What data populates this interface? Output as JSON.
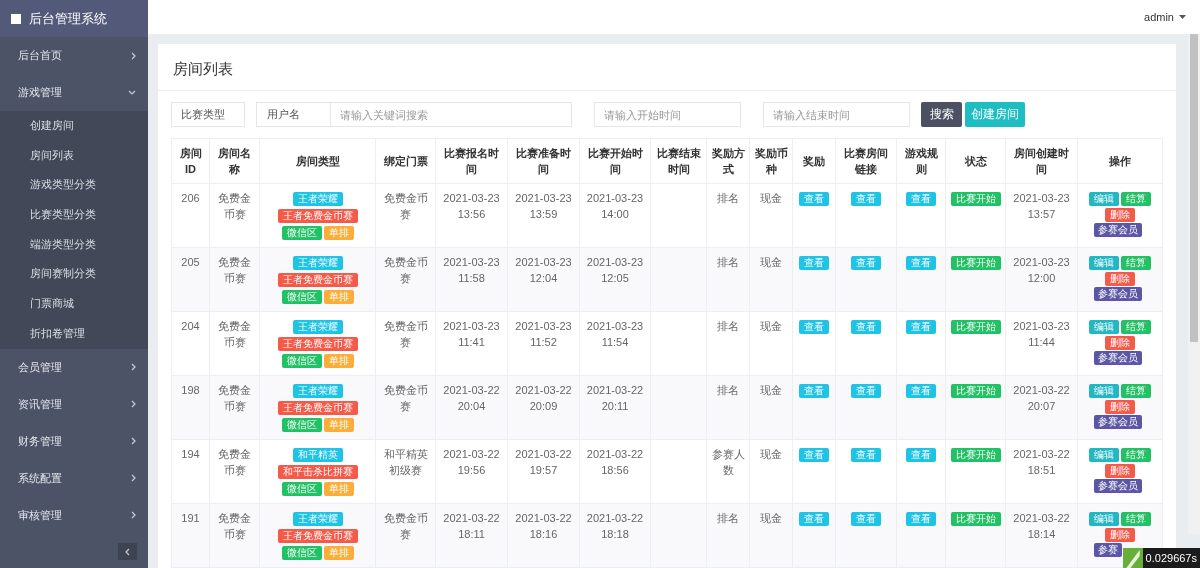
{
  "app_title": "后台管理系统",
  "user": "admin",
  "sidebar": [
    {
      "label": "后台首页",
      "expanded": false
    },
    {
      "label": "游戏管理",
      "expanded": true,
      "children": [
        "创建房间",
        "房间列表",
        "游戏类型分类",
        "比赛类型分类",
        "端游类型分类",
        "房间赛制分类",
        "门票商城",
        "折扣卷管理"
      ]
    },
    {
      "label": "会员管理",
      "expanded": false
    },
    {
      "label": "资讯管理",
      "expanded": false
    },
    {
      "label": "财务管理",
      "expanded": false
    },
    {
      "label": "系统配置",
      "expanded": false
    },
    {
      "label": "审核管理",
      "expanded": false
    }
  ],
  "page_title": "房间列表",
  "filters": {
    "type_select": "比赛类型",
    "keyword_label": "用户名",
    "keyword_placeholder": "请输入关键词搜索",
    "start_placeholder": "请输入开始时间",
    "end_placeholder": "请输入结束时间",
    "search_button": "搜索",
    "create_button": "创建房间"
  },
  "table": {
    "columns": [
      "房间ID",
      "房间名称",
      "房间类型",
      "绑定门票",
      "比赛报名时间",
      "比赛准备时间",
      "比赛开始时间",
      "比赛结束时间",
      "奖励方式",
      "奖励币种",
      "奖励",
      "比赛房间链接",
      "游戏规则",
      "状态",
      "房间创建时间",
      "操作"
    ],
    "rows": [
      {
        "id": "206",
        "name": "免费金币赛",
        "tags": [
          {
            "label": "王者荣耀",
            "color": "#1ec3e6"
          },
          {
            "label": "王者免费金币赛",
            "color": "#f35a4a"
          },
          {
            "label": "微信区",
            "color": "#23c165"
          },
          {
            "label": "单排",
            "color": "#fbad3b"
          }
        ],
        "ticket": "免费金币赛",
        "signup": "2021-03-23 13:56",
        "prep": "2021-03-23 13:59",
        "start": "2021-03-23 14:00",
        "reward_method": "排名",
        "currency": "现金",
        "reward": "查看",
        "link": "查看",
        "rules": "查看",
        "status": {
          "label": "比赛开始",
          "color": "#23c165"
        },
        "created": "2021-03-23 13:57",
        "actions": [
          {
            "label": "编辑",
            "color": "#23b7c3"
          },
          {
            "label": "结算",
            "color": "#23c165"
          },
          {
            "label": "删除",
            "color": "#f35a4a"
          },
          {
            "label": "参赛会员",
            "color": "#5b56a6"
          }
        ]
      },
      {
        "id": "205",
        "name": "免费金币赛",
        "tags": [
          {
            "label": "王者荣耀",
            "color": "#1ec3e6"
          },
          {
            "label": "王者免费金币赛",
            "color": "#f35a4a"
          },
          {
            "label": "微信区",
            "color": "#23c165"
          },
          {
            "label": "单排",
            "color": "#fbad3b"
          }
        ],
        "ticket": "免费金币赛",
        "signup": "2021-03-23 11:58",
        "prep": "2021-03-23 12:04",
        "start": "2021-03-23 12:05",
        "reward_method": "排名",
        "currency": "现金",
        "reward": "查看",
        "link": "查看",
        "rules": "查看",
        "status": {
          "label": "比赛开始",
          "color": "#23c165"
        },
        "created": "2021-03-23 12:00",
        "actions": [
          {
            "label": "编辑",
            "color": "#23b7c3"
          },
          {
            "label": "结算",
            "color": "#23c165"
          },
          {
            "label": "删除",
            "color": "#f35a4a"
          },
          {
            "label": "参赛会员",
            "color": "#5b56a6"
          }
        ]
      },
      {
        "id": "204",
        "name": "免费金币赛",
        "tags": [
          {
            "label": "王者荣耀",
            "color": "#1ec3e6"
          },
          {
            "label": "王者免费金币赛",
            "color": "#f35a4a"
          },
          {
            "label": "微信区",
            "color": "#23c165"
          },
          {
            "label": "单排",
            "color": "#fbad3b"
          }
        ],
        "ticket": "免费金币赛",
        "signup": "2021-03-23 11:41",
        "prep": "2021-03-23 11:52",
        "start": "2021-03-23 11:54",
        "reward_method": "排名",
        "currency": "现金",
        "reward": "查看",
        "link": "查看",
        "rules": "查看",
        "status": {
          "label": "比赛开始",
          "color": "#23c165"
        },
        "created": "2021-03-23 11:44",
        "actions": [
          {
            "label": "编辑",
            "color": "#23b7c3"
          },
          {
            "label": "结算",
            "color": "#23c165"
          },
          {
            "label": "删除",
            "color": "#f35a4a"
          },
          {
            "label": "参赛会员",
            "color": "#5b56a6"
          }
        ]
      },
      {
        "id": "198",
        "name": "免费金币赛",
        "tags": [
          {
            "label": "王者荣耀",
            "color": "#1ec3e6"
          },
          {
            "label": "王者免费金币赛",
            "color": "#f35a4a"
          },
          {
            "label": "微信区",
            "color": "#23c165"
          },
          {
            "label": "单排",
            "color": "#fbad3b"
          }
        ],
        "ticket": "免费金币赛",
        "signup": "2021-03-22 20:04",
        "prep": "2021-03-22 20:09",
        "start": "2021-03-22 20:11",
        "reward_method": "排名",
        "currency": "现金",
        "reward": "查看",
        "link": "查看",
        "rules": "查看",
        "status": {
          "label": "比赛开始",
          "color": "#23c165"
        },
        "created": "2021-03-22 20:07",
        "actions": [
          {
            "label": "编辑",
            "color": "#23b7c3"
          },
          {
            "label": "结算",
            "color": "#23c165"
          },
          {
            "label": "删除",
            "color": "#f35a4a"
          },
          {
            "label": "参赛会员",
            "color": "#5b56a6"
          }
        ]
      },
      {
        "id": "194",
        "name": "免费金币赛",
        "tags": [
          {
            "label": "和平精英",
            "color": "#1ec3e6"
          },
          {
            "label": "和平击杀比拼赛",
            "color": "#f35a4a"
          },
          {
            "label": "微信区",
            "color": "#23c165"
          },
          {
            "label": "单排",
            "color": "#fbad3b"
          }
        ],
        "ticket": "和平精英初级赛",
        "signup": "2021-03-22 19:56",
        "prep": "2021-03-22 19:57",
        "start": "2021-03-22 18:56",
        "reward_method": "参赛人数",
        "currency": "现金",
        "reward": "查看",
        "link": "查看",
        "rules": "查看",
        "status": {
          "label": "比赛开始",
          "color": "#23c165"
        },
        "created": "2021-03-22 18:51",
        "actions": [
          {
            "label": "编辑",
            "color": "#23b7c3"
          },
          {
            "label": "结算",
            "color": "#23c165"
          },
          {
            "label": "删除",
            "color": "#f35a4a"
          },
          {
            "label": "参赛会员",
            "color": "#5b56a6"
          }
        ]
      },
      {
        "id": "191",
        "name": "免费金币赛",
        "tags": [
          {
            "label": "王者荣耀",
            "color": "#1ec3e6"
          },
          {
            "label": "王者免费金币赛",
            "color": "#f35a4a"
          },
          {
            "label": "微信区",
            "color": "#23c165"
          },
          {
            "label": "单排",
            "color": "#fbad3b"
          }
        ],
        "ticket": "免费金币赛",
        "signup": "2021-03-22 18:11",
        "prep": "2021-03-22 18:16",
        "start": "2021-03-22 18:18",
        "reward_method": "排名",
        "currency": "现金",
        "reward": "查看",
        "link": "查看",
        "rules": "查看",
        "status": {
          "label": "比赛开始",
          "color": "#23c165"
        },
        "created": "2021-03-22 18:14",
        "actions": [
          {
            "label": "编辑",
            "color": "#23b7c3"
          },
          {
            "label": "结算",
            "color": "#23c165"
          },
          {
            "label": "删除",
            "color": "#f35a4a"
          },
          {
            "label": "参赛",
            "color": "#5b56a6"
          }
        ]
      }
    ]
  },
  "debug_time": "0.029667s"
}
